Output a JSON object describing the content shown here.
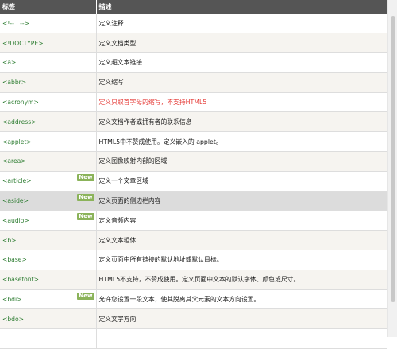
{
  "table": {
    "headers": {
      "tag": "标签",
      "description": "描述"
    },
    "rows": [
      {
        "tag": "<!--...-->",
        "description": "定义注释",
        "badge": ""
      },
      {
        "tag": "<!DOCTYPE>",
        "description": "定义文档类型",
        "badge": ""
      },
      {
        "tag": "<a>",
        "description": "定义超文本链接",
        "badge": ""
      },
      {
        "tag": "<abbr>",
        "description": "定义缩写",
        "badge": ""
      },
      {
        "tag": "<acronym>",
        "description": "定义只取首字母的缩写，不支持HTML5",
        "badge": ""
      },
      {
        "tag": "<address>",
        "description": "定义文档作者或拥有者的联系信息",
        "badge": ""
      },
      {
        "tag": "<applet>",
        "description": "HTML5中不赞成使用。定义嵌入的 applet。",
        "badge": ""
      },
      {
        "tag": "<area>",
        "description": "定义图像映射内部的区域",
        "badge": ""
      },
      {
        "tag": "<article>",
        "description": "定义一个文章区域",
        "badge": "New"
      },
      {
        "tag": "<aside>",
        "description": "定义页面的侧边栏内容",
        "badge": "New"
      },
      {
        "tag": "<audio>",
        "description": "定义音频内容",
        "badge": "New"
      },
      {
        "tag": "<b>",
        "description": "定义文本粗体",
        "badge": ""
      },
      {
        "tag": "<base>",
        "description": "定义页面中所有链接的默认地址或默认目标。",
        "badge": ""
      },
      {
        "tag": "<basefont>",
        "description": "HTML5不支持，不赞成使用。定义页面中文本的默认字体、颜色或尺寸。",
        "badge": ""
      },
      {
        "tag": "<bdi>",
        "description": "允许您设置一段文本，使其脱离其父元素的文本方向设置。",
        "badge": "New"
      },
      {
        "tag": "<bdo>",
        "description": "定义文字方向",
        "badge": ""
      },
      {
        "tag": "",
        "description": "",
        "badge": ""
      }
    ]
  },
  "colors": {
    "header_bg": "#555555",
    "tag_text": "#2e7d32",
    "warning_text": "#e53935",
    "badge_bg": "#8bb35a",
    "row_alt_bg": "#f6f4f0",
    "row_highlight_bg": "#dcdcdc"
  }
}
